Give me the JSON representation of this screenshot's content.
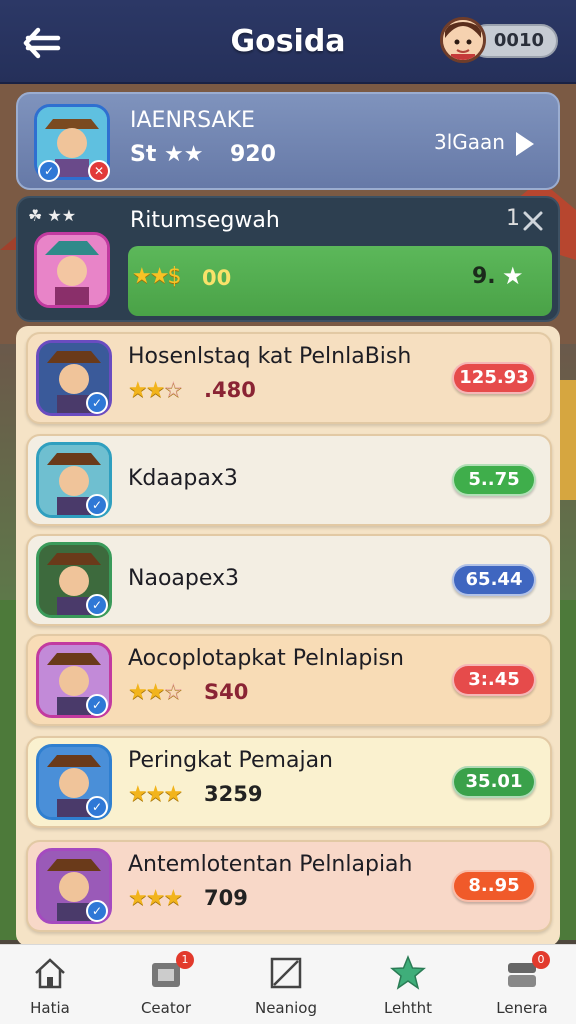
{
  "header": {
    "title": "Gosida",
    "coins": "0010",
    "back_icon": "back-arrow-icon"
  },
  "top_card": {
    "name": "IAENRSAKE",
    "stars_text": "St ★★",
    "score": "920",
    "link_label": "3lGaan"
  },
  "selected_card": {
    "name": "Ritumsegwah",
    "prefix_icons": "☘ ★★",
    "score": "00",
    "rating": "9.",
    "close_label": "1"
  },
  "rows": [
    {
      "name": "Hosenlstaq kat PelnlaBish",
      "score": ".480",
      "stars": 2,
      "pill": "125.93",
      "pill_color": "#e64b4b",
      "bg": "#f6dfc0"
    },
    {
      "name": "Kdaapax3",
      "score": "",
      "stars": 0,
      "pill": "5..75",
      "pill_color": "#3fae4b",
      "bg": "#f3eee3"
    },
    {
      "name": "Naoapex3",
      "score": "",
      "stars": 0,
      "pill": "65.44",
      "pill_color": "#3f66c0",
      "bg": "#f3eee3"
    },
    {
      "name": "Aocoplotapkat Pelnlapisn",
      "score": "S40",
      "stars": 2,
      "pill": "3:.45",
      "pill_color": "#e64b4b",
      "bg": "#f8dcb6"
    },
    {
      "name": "Peringkat Pemajan",
      "score": "3259",
      "stars": 3,
      "pill": "35.01",
      "pill_color": "#3aa14a",
      "bg": "#faf1cf"
    },
    {
      "name": "Antemlotentan Pelnlapiah",
      "score": "709",
      "stars": 3,
      "pill": "8..95",
      "pill_color": "#f05a2a",
      "bg": "#f8d8c8"
    }
  ],
  "nav": [
    {
      "label": "Hatia",
      "icon": "home-icon",
      "badge": ""
    },
    {
      "label": "Ceator",
      "icon": "shop-icon",
      "badge": "1"
    },
    {
      "label": "Neaniog",
      "icon": "edit-icon",
      "badge": ""
    },
    {
      "label": "Lehtht",
      "icon": "star-icon",
      "badge": ""
    },
    {
      "label": "Lenera",
      "icon": "profile-icon",
      "badge": "0"
    }
  ],
  "colors": {
    "header": "#2c3866",
    "selected_green": "#5cb85a",
    "star": "#f2b41c"
  }
}
